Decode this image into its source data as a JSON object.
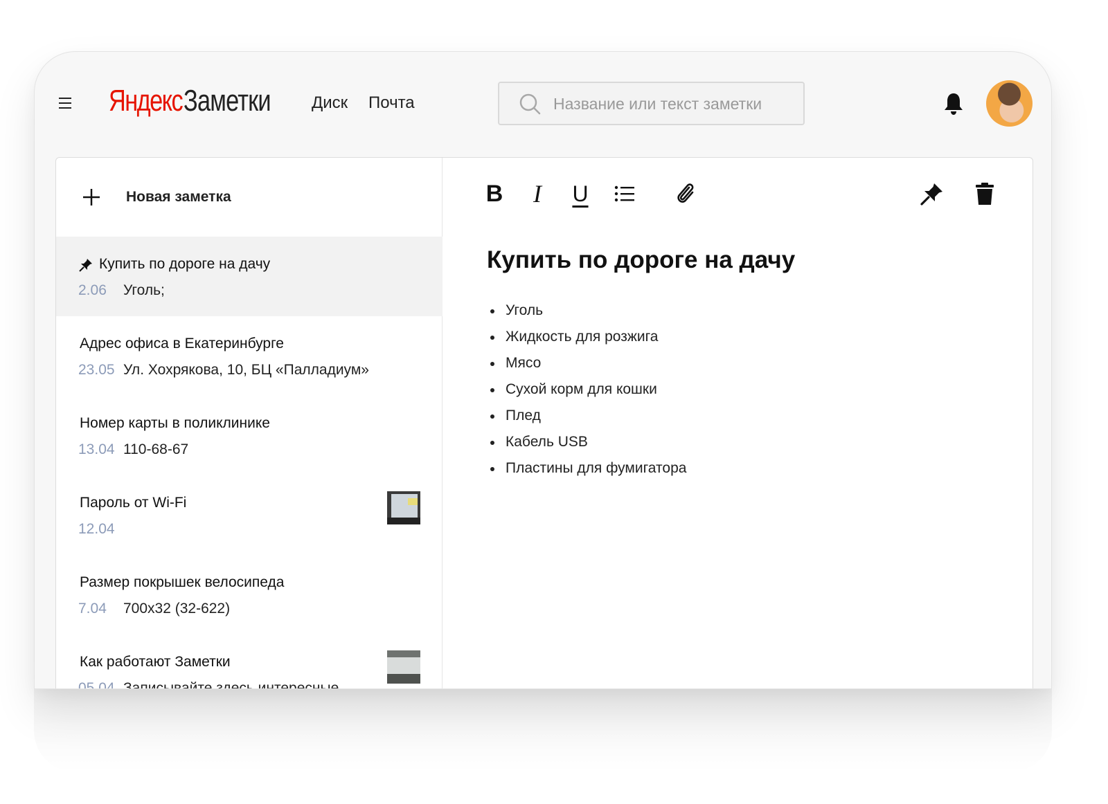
{
  "header": {
    "logo_brand": "Яндекс",
    "logo_service": "Заметки",
    "nav": [
      "Диск",
      "Почта"
    ],
    "search_placeholder": "Название или текст заметки"
  },
  "sidebar": {
    "new_note_label": "Новая заметка",
    "notes": [
      {
        "title": "Купить по дороге на дачу",
        "date": "2.06",
        "text": "Уголь;",
        "pinned": true,
        "active": true,
        "thumb": false
      },
      {
        "title": "Адрес офиса в Екатеринбурге",
        "date": "23.05",
        "text": "Ул. Хохрякова, 10, БЦ «Палладиум»",
        "pinned": false,
        "active": false,
        "thumb": false
      },
      {
        "title": "Номер карты в поликлинике",
        "date": "13.04",
        "text": "110-68-67",
        "pinned": false,
        "active": false,
        "thumb": false
      },
      {
        "title": "Пароль от Wi-Fi",
        "date": "12.04",
        "text": "",
        "pinned": false,
        "active": false,
        "thumb": true
      },
      {
        "title": "Размер покрышек велосипеда",
        "date": "7.04",
        "text": "700x32 (32-622)",
        "pinned": false,
        "active": false,
        "thumb": false
      },
      {
        "title": "Как работают Заметки",
        "date": "05.04",
        "text": "Записывайте здесь интересные",
        "pinned": false,
        "active": false,
        "thumb": true
      }
    ]
  },
  "editor": {
    "toolbar": {
      "bold": "B",
      "italic": "I",
      "underline": "U"
    },
    "title": "Купить по дороге на дачу",
    "items": [
      "Уголь",
      "Жидкость для розжига",
      "Мясо",
      "Сухой корм для кошки",
      "Плед",
      "Кабель USB",
      "Пластины для фумигатора"
    ]
  },
  "colors": {
    "brand": "#e61400",
    "date": "#8c9bb8",
    "active_row": "#f2f2f2"
  }
}
